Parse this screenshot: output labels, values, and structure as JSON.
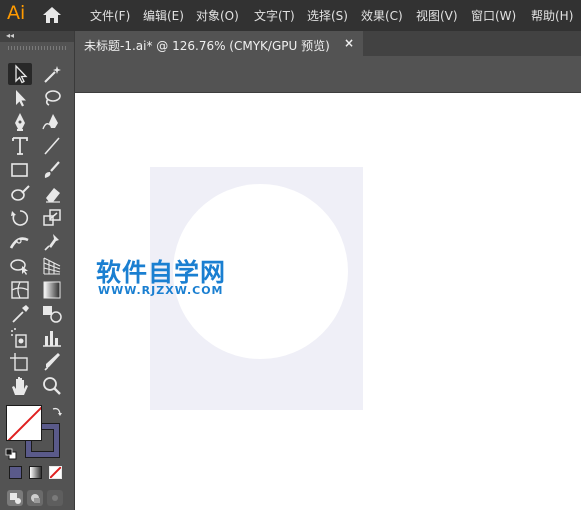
{
  "app": {
    "logo": "Ai",
    "home_icon": "home-icon"
  },
  "menu": [
    "文件(F)",
    "编辑(E)",
    "对象(O)",
    "文字(T)",
    "选择(S)",
    "效果(C)",
    "视图(V)",
    "窗口(W)",
    "帮助(H)"
  ],
  "toolbar": {
    "collapse_glyph": "◂◂",
    "tools": [
      "selection-tool-icon",
      "magic-wand-tool-icon",
      "direct-selection-tool-icon",
      "lasso-tool-icon",
      "pen-tool-icon",
      "curvature-tool-icon",
      "type-tool-icon",
      "line-segment-tool-icon",
      "rectangle-tool-icon",
      "paintbrush-tool-icon",
      "shaper-tool-icon",
      "eraser-tool-icon",
      "rotate-tool-icon",
      "scale-tool-icon",
      "width-tool-icon",
      "puppet-warp-tool-icon",
      "shape-builder-tool-icon",
      "perspective-grid-tool-icon",
      "mesh-tool-icon",
      "gradient-tool-icon",
      "eyedropper-tool-icon",
      "blend-tool-icon",
      "symbol-sprayer-tool-icon",
      "column-graph-tool-icon",
      "artboard-tool-icon",
      "slice-tool-icon",
      "hand-tool-icon",
      "zoom-tool-icon"
    ],
    "colors": {
      "stroke": "#5a5a8a",
      "fill": "#ffffff",
      "none_slash": "#e02020"
    }
  },
  "document_tab": {
    "title": "未标题-1.ai* @ 126.76% (CMYK/GPU 预览)",
    "close": "×"
  },
  "canvas": {
    "shape_color": "#efeff7",
    "watermark_title": "软件自学网",
    "watermark_url": "WWW.RJZXW.COM",
    "watermark_color": "#1a7fd1"
  }
}
